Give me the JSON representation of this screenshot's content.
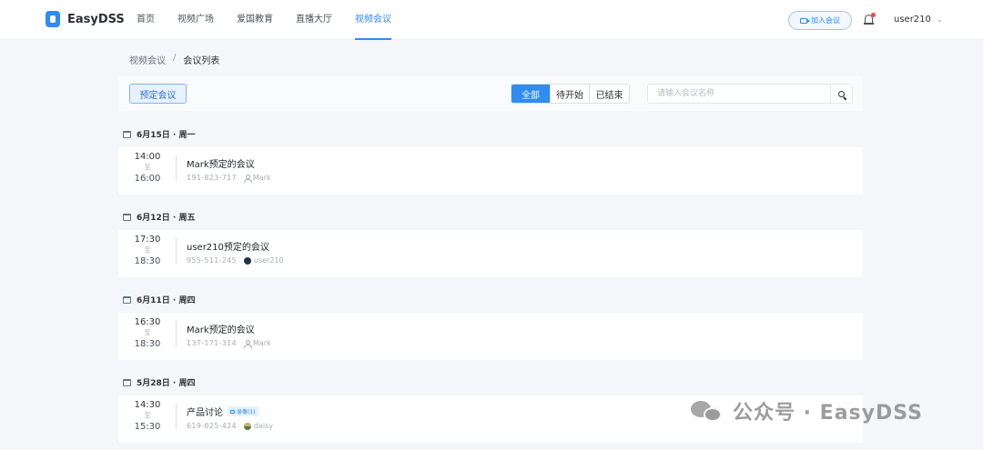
{
  "header": {
    "brand": "EasyDSS",
    "nav": [
      {
        "label": "首页",
        "active": false
      },
      {
        "label": "视频广场",
        "active": false
      },
      {
        "label": "爱国教育",
        "active": false
      },
      {
        "label": "直播大厅",
        "active": false
      },
      {
        "label": "视频会议",
        "active": true
      }
    ],
    "join_label": "加入会议",
    "username": "user210"
  },
  "breadcrumb": {
    "parent": "视频会议",
    "separator": "/",
    "current": "会议列表"
  },
  "toolbar": {
    "book_label": "预定会议",
    "filters": [
      {
        "label": "全部",
        "active": true
      },
      {
        "label": "待开始",
        "active": false
      },
      {
        "label": "已结束",
        "active": false
      }
    ],
    "search_placeholder": "请输入会议名称"
  },
  "groups": [
    {
      "date": "6月15日 · 周一",
      "meeting": {
        "start": "14:00",
        "to": "至",
        "end": "16:00",
        "title": "Mark预定的会议",
        "number": "191-823-717",
        "owner": "Mark",
        "owner_icon": "person-icon",
        "badge": ""
      }
    },
    {
      "date": "6月12日 · 周五",
      "meeting": {
        "start": "17:30",
        "to": "至",
        "end": "18:30",
        "title": "user210预定的会议",
        "number": "955-511-245",
        "owner": "user210",
        "owner_icon": "avatar",
        "badge": ""
      }
    },
    {
      "date": "6月11日 · 周四",
      "meeting": {
        "start": "16:30",
        "to": "至",
        "end": "18:30",
        "title": "Mark预定的会议",
        "number": "137-171-314",
        "owner": "Mark",
        "owner_icon": "person-icon",
        "badge": ""
      }
    },
    {
      "date": "5月28日 · 周四",
      "meeting": {
        "start": "14:30",
        "to": "至",
        "end": "15:30",
        "title": "产品讨论",
        "number": "619-025-424",
        "owner": "daisy",
        "owner_icon": "avatar",
        "badge": "录像(1)"
      }
    }
  ],
  "watermark": "公众号 · EasyDSS",
  "colors": {
    "accent": "#2f8cf0",
    "background": "#f4f6f9",
    "card": "#ffffff"
  }
}
